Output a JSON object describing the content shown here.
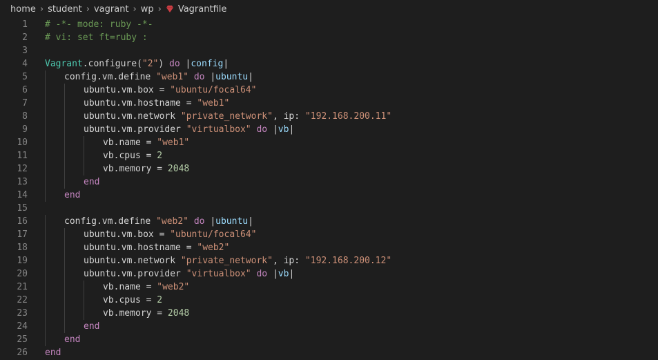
{
  "breadcrumb": {
    "items": [
      "home",
      "student",
      "vagrant",
      "wp"
    ],
    "file": "Vagrantfile",
    "file_icon": "ruby-gem-icon",
    "file_icon_color": "#cc3e44"
  },
  "colors": {
    "background": "#1e1e1e",
    "line_number": "#858585",
    "comment": "#6a9955",
    "constant": "#4ec9b0",
    "string": "#ce9178",
    "keyword": "#c586c0",
    "parameter": "#9cdcfe",
    "number": "#b5cea8",
    "text": "#d4d4d4"
  },
  "editor": {
    "lines": [
      {
        "n": "1",
        "indent": 0,
        "tokens": [
          {
            "t": "# -*- mode: ruby -*-",
            "k": "comment"
          }
        ]
      },
      {
        "n": "2",
        "indent": 0,
        "tokens": [
          {
            "t": "# vi: set ft=ruby :",
            "k": "comment"
          }
        ]
      },
      {
        "n": "3",
        "indent": 0,
        "tokens": []
      },
      {
        "n": "4",
        "indent": 0,
        "tokens": [
          {
            "t": "Vagrant",
            "k": "const"
          },
          {
            "t": ".configure(",
            "k": "plain"
          },
          {
            "t": "\"2\"",
            "k": "string"
          },
          {
            "t": ") ",
            "k": "plain"
          },
          {
            "t": "do",
            "k": "keyword"
          },
          {
            "t": " |",
            "k": "plain"
          },
          {
            "t": "config",
            "k": "param"
          },
          {
            "t": "|",
            "k": "plain"
          }
        ]
      },
      {
        "n": "5",
        "indent": 1,
        "tokens": [
          {
            "t": "config.vm.define ",
            "k": "plain"
          },
          {
            "t": "\"web1\"",
            "k": "string"
          },
          {
            "t": " ",
            "k": "plain"
          },
          {
            "t": "do",
            "k": "keyword"
          },
          {
            "t": " |",
            "k": "plain"
          },
          {
            "t": "ubuntu",
            "k": "param"
          },
          {
            "t": "|",
            "k": "plain"
          }
        ]
      },
      {
        "n": "6",
        "indent": 2,
        "tokens": [
          {
            "t": "ubuntu.vm.box = ",
            "k": "plain"
          },
          {
            "t": "\"ubuntu/focal64\"",
            "k": "string"
          }
        ]
      },
      {
        "n": "7",
        "indent": 2,
        "tokens": [
          {
            "t": "ubuntu.vm.hostname = ",
            "k": "plain"
          },
          {
            "t": "\"web1\"",
            "k": "string"
          }
        ]
      },
      {
        "n": "8",
        "indent": 2,
        "tokens": [
          {
            "t": "ubuntu.vm.network ",
            "k": "plain"
          },
          {
            "t": "\"private_network\"",
            "k": "string"
          },
          {
            "t": ", ip: ",
            "k": "plain"
          },
          {
            "t": "\"192.168.200.11\"",
            "k": "string"
          }
        ]
      },
      {
        "n": "9",
        "indent": 2,
        "tokens": [
          {
            "t": "ubuntu.vm.provider ",
            "k": "plain"
          },
          {
            "t": "\"virtualbox\"",
            "k": "string"
          },
          {
            "t": " ",
            "k": "plain"
          },
          {
            "t": "do",
            "k": "keyword"
          },
          {
            "t": " |",
            "k": "plain"
          },
          {
            "t": "vb",
            "k": "param"
          },
          {
            "t": "|",
            "k": "plain"
          }
        ]
      },
      {
        "n": "10",
        "indent": 3,
        "tokens": [
          {
            "t": "vb.name = ",
            "k": "plain"
          },
          {
            "t": "\"web1\"",
            "k": "string"
          }
        ]
      },
      {
        "n": "11",
        "indent": 3,
        "tokens": [
          {
            "t": "vb.cpus = ",
            "k": "plain"
          },
          {
            "t": "2",
            "k": "number"
          }
        ]
      },
      {
        "n": "12",
        "indent": 3,
        "tokens": [
          {
            "t": "vb.memory = ",
            "k": "plain"
          },
          {
            "t": "2048",
            "k": "number"
          }
        ]
      },
      {
        "n": "13",
        "indent": 2,
        "tokens": [
          {
            "t": "end",
            "k": "keyword"
          }
        ]
      },
      {
        "n": "14",
        "indent": 1,
        "tokens": [
          {
            "t": "end",
            "k": "keyword"
          }
        ]
      },
      {
        "n": "15",
        "indent": 0,
        "tokens": []
      },
      {
        "n": "16",
        "indent": 1,
        "tokens": [
          {
            "t": "config.vm.define ",
            "k": "plain"
          },
          {
            "t": "\"web2\"",
            "k": "string"
          },
          {
            "t": " ",
            "k": "plain"
          },
          {
            "t": "do",
            "k": "keyword"
          },
          {
            "t": " |",
            "k": "plain"
          },
          {
            "t": "ubuntu",
            "k": "param"
          },
          {
            "t": "|",
            "k": "plain"
          }
        ]
      },
      {
        "n": "17",
        "indent": 2,
        "tokens": [
          {
            "t": "ubuntu.vm.box = ",
            "k": "plain"
          },
          {
            "t": "\"ubuntu/focal64\"",
            "k": "string"
          }
        ]
      },
      {
        "n": "18",
        "indent": 2,
        "tokens": [
          {
            "t": "ubuntu.vm.hostname = ",
            "k": "plain"
          },
          {
            "t": "\"web2\"",
            "k": "string"
          }
        ]
      },
      {
        "n": "19",
        "indent": 2,
        "tokens": [
          {
            "t": "ubuntu.vm.network ",
            "k": "plain"
          },
          {
            "t": "\"private_network\"",
            "k": "string"
          },
          {
            "t": ", ip: ",
            "k": "plain"
          },
          {
            "t": "\"192.168.200.12\"",
            "k": "string"
          }
        ]
      },
      {
        "n": "20",
        "indent": 2,
        "tokens": [
          {
            "t": "ubuntu.vm.provider ",
            "k": "plain"
          },
          {
            "t": "\"virtualbox\"",
            "k": "string"
          },
          {
            "t": " ",
            "k": "plain"
          },
          {
            "t": "do",
            "k": "keyword"
          },
          {
            "t": " |",
            "k": "plain"
          },
          {
            "t": "vb",
            "k": "param"
          },
          {
            "t": "|",
            "k": "plain"
          }
        ]
      },
      {
        "n": "21",
        "indent": 3,
        "tokens": [
          {
            "t": "vb.name = ",
            "k": "plain"
          },
          {
            "t": "\"web2\"",
            "k": "string"
          }
        ]
      },
      {
        "n": "22",
        "indent": 3,
        "tokens": [
          {
            "t": "vb.cpus = ",
            "k": "plain"
          },
          {
            "t": "2",
            "k": "number"
          }
        ]
      },
      {
        "n": "23",
        "indent": 3,
        "tokens": [
          {
            "t": "vb.memory = ",
            "k": "plain"
          },
          {
            "t": "2048",
            "k": "number"
          }
        ]
      },
      {
        "n": "24",
        "indent": 2,
        "tokens": [
          {
            "t": "end",
            "k": "keyword"
          }
        ]
      },
      {
        "n": "25",
        "indent": 1,
        "tokens": [
          {
            "t": "end",
            "k": "keyword"
          }
        ]
      },
      {
        "n": "26",
        "indent": 0,
        "tokens": [
          {
            "t": "end",
            "k": "keyword"
          }
        ]
      }
    ]
  }
}
